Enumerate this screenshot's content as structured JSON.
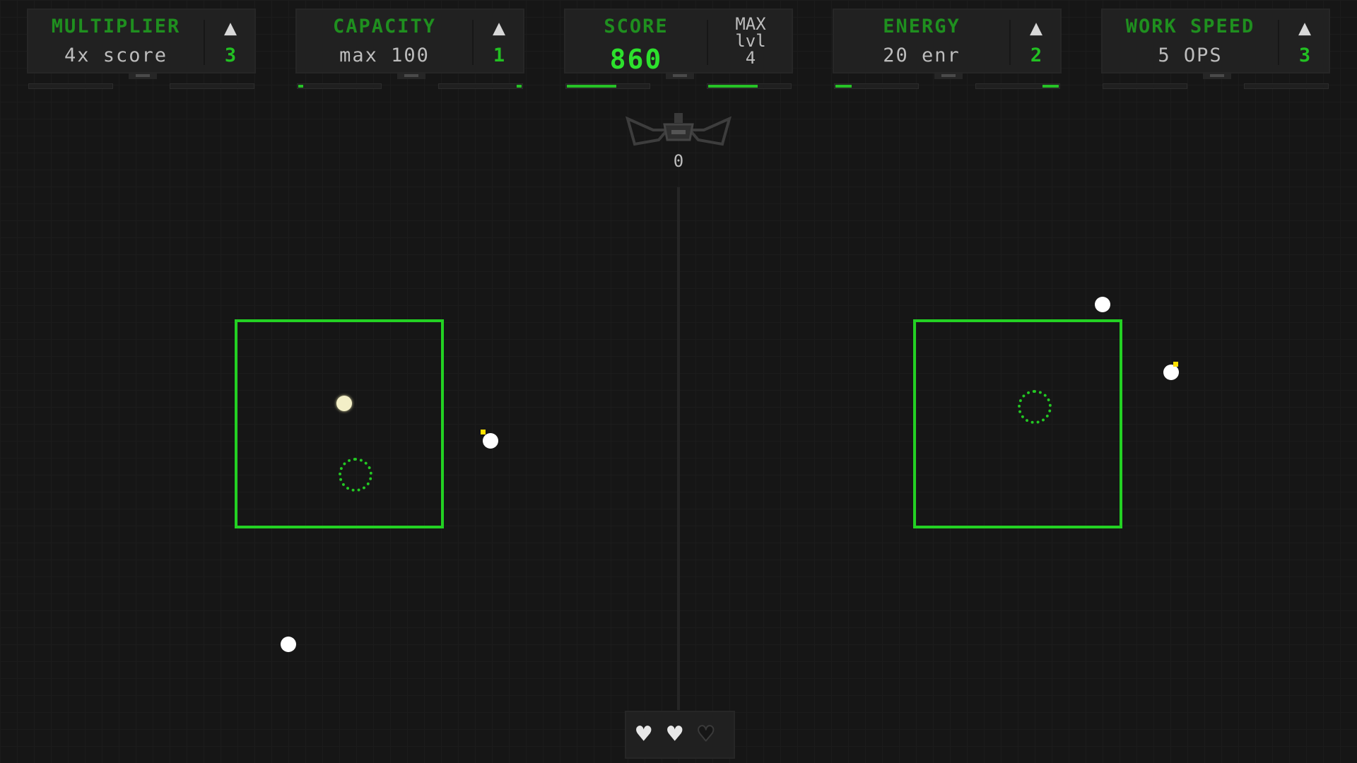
{
  "upgrades": [
    {
      "label": "MULTIPLIER",
      "value": "4x score",
      "level": "3",
      "bar_fill": [
        0.0,
        0.0
      ]
    },
    {
      "label": "CAPACITY",
      "value": "max 100",
      "level": "1",
      "bar_fill": [
        0.06,
        0.06
      ]
    },
    {
      "label": "ENERGY",
      "value": "20 enr",
      "level": "2",
      "bar_fill": [
        0.2,
        0.2
      ]
    },
    {
      "label": "WORK SPEED",
      "value": "5 OPS",
      "level": "3",
      "bar_fill": [
        0.0,
        0.0
      ]
    }
  ],
  "score": {
    "label": "SCORE",
    "value": "860",
    "max_label": "MAX",
    "lvl_label": "lvl",
    "lvl_value": "4",
    "bar_fill": [
      0.6,
      0.6
    ]
  },
  "enemy": {
    "icon": "winged-ship-icon",
    "count": "0"
  },
  "lives": {
    "total": 3,
    "remaining": 2,
    "icon": "heart-icon"
  },
  "colors": {
    "accent": "#23d123",
    "label_green": "#1f8f1f",
    "score_green": "#2de12d",
    "background": "#161616",
    "panel": "#212121",
    "projectile": "#ffffff",
    "spark": "#ffe000"
  }
}
